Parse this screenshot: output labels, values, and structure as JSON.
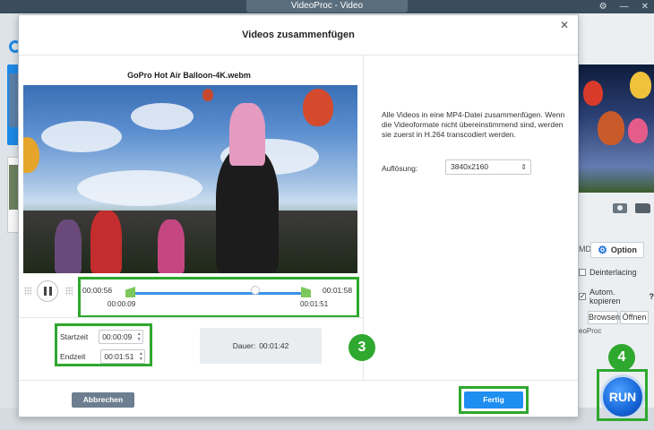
{
  "app": {
    "window_title": "VideoProc - Video",
    "option_label": "Option",
    "md_label": "MD",
    "deinterlacing_label": "Deinterlacing",
    "auto_copy_label": "Autom. kopieren",
    "help_mark": "?",
    "browse_label": "Browsen",
    "open_label": "Öffnen",
    "footer_text": "eoProc",
    "run_label": "RUN"
  },
  "dialog": {
    "title": "Videos zusammenfügen",
    "filename": "GoPro Hot Air Balloon-4K.webm",
    "timeline": {
      "start_time": "00:00:56",
      "end_time": "00:01:58",
      "marker_start": "00:00:09",
      "marker_end": "00:01:51"
    },
    "start_label": "Startzeit",
    "start_value": "00:00:09",
    "end_label": "Endzeit",
    "end_value": "00:01:51",
    "duration_label": "Dauer:",
    "duration_value": "00:01:42",
    "info_text": "Alle Videos in eine MP4-Datei zusammenfügen. Wenn die Videoformate nicht übereinstimmend sind, werden sie zuerst in H.264 transcodiert werden.",
    "resolution_label": "Auflösung:",
    "resolution_value": "3840x2160",
    "cancel_label": "Abbrechen",
    "done_label": "Fertig"
  },
  "annotations": {
    "step3": "3",
    "step4": "4",
    "highlight_color": "#2ea82e"
  }
}
